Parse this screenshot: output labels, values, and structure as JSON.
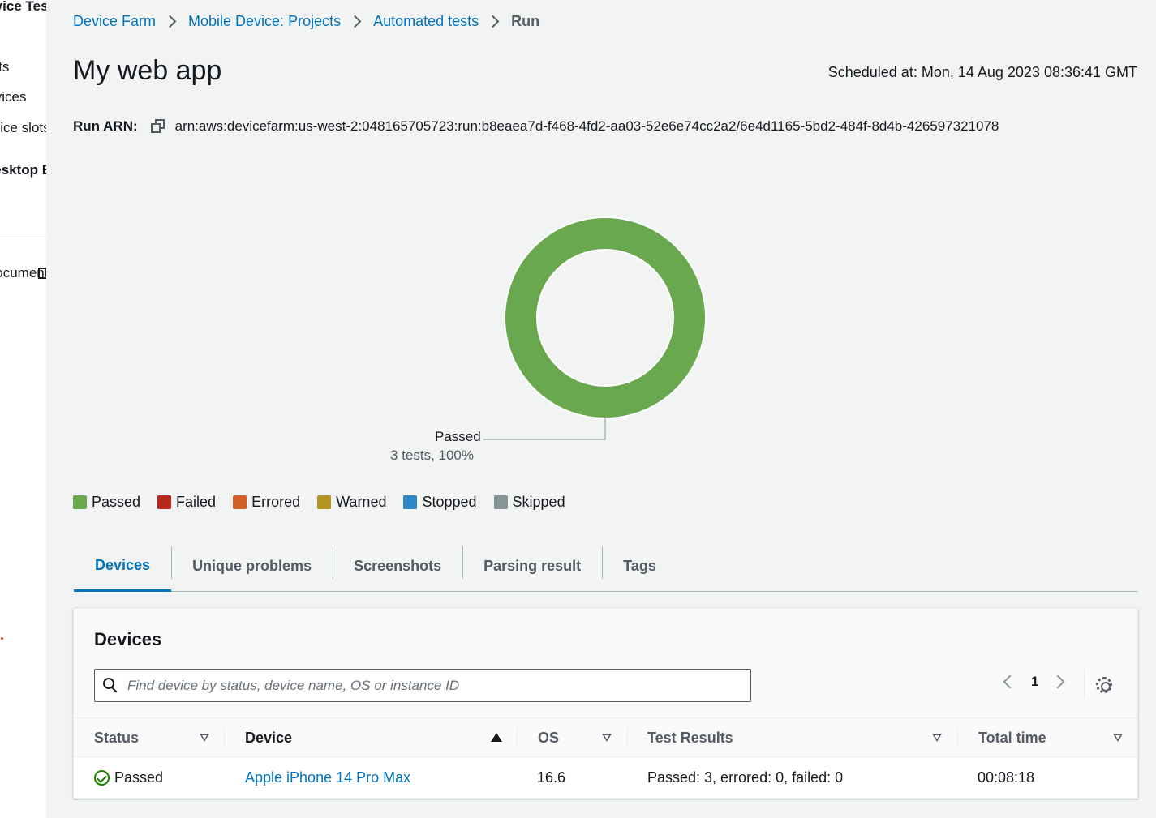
{
  "sidebar": {
    "title": "Device Testing",
    "items": [
      "Projects",
      "Devices",
      "Device slots",
      "Desktop Browser"
    ],
    "documentation": "Documentation"
  },
  "breadcrumb": {
    "items": [
      "Device Farm",
      "Mobile Device: Projects",
      "Automated tests"
    ],
    "current": "Run"
  },
  "header": {
    "title": "My web app",
    "scheduled": "Scheduled at: Mon, 14 Aug 2023 08:36:41 GMT"
  },
  "run_arn": {
    "label": "Run ARN:",
    "value": "arn:aws:devicefarm:us-west-2:048165705723:run:b8eaea7d-f468-4fd2-aa03-52e6e74cc2a2/6e4d1165-5bd2-484f-8d4b-426597321078"
  },
  "chart_data": {
    "type": "pie",
    "donut": true,
    "categories": [
      "Passed",
      "Failed",
      "Errored",
      "Warned",
      "Stopped",
      "Skipped"
    ],
    "values": [
      3,
      0,
      0,
      0,
      0,
      0
    ],
    "colors": [
      "#6aa84f",
      "#b7281a",
      "#d2602b",
      "#b39521",
      "#2f86c6",
      "#879596"
    ],
    "annotation": {
      "name": "Passed",
      "detail": "3 tests, 100%"
    },
    "legend": "bottom-left"
  },
  "legend": [
    {
      "label": "Passed",
      "color": "#6aa84f"
    },
    {
      "label": "Failed",
      "color": "#b7281a"
    },
    {
      "label": "Errored",
      "color": "#d2602b"
    },
    {
      "label": "Warned",
      "color": "#b39521"
    },
    {
      "label": "Stopped",
      "color": "#2f86c6"
    },
    {
      "label": "Skipped",
      "color": "#879596"
    }
  ],
  "tabs": [
    "Devices",
    "Unique problems",
    "Screenshots",
    "Parsing result",
    "Tags"
  ],
  "devices_panel": {
    "title": "Devices",
    "search_placeholder": "Find device by status, device name, OS or instance ID",
    "page": "1",
    "columns": [
      "Status",
      "Device",
      "OS",
      "Test Results",
      "Total time"
    ],
    "rows": [
      {
        "status": "Passed",
        "device": "Apple iPhone 14 Pro Max",
        "os": "16.6",
        "results": "Passed: 3, errored: 0, failed: 0",
        "time": "00:08:18"
      }
    ]
  },
  "colors": {
    "accent": "#0073bb",
    "passed": "#6aa84f",
    "success_icon": "#1d8102"
  }
}
